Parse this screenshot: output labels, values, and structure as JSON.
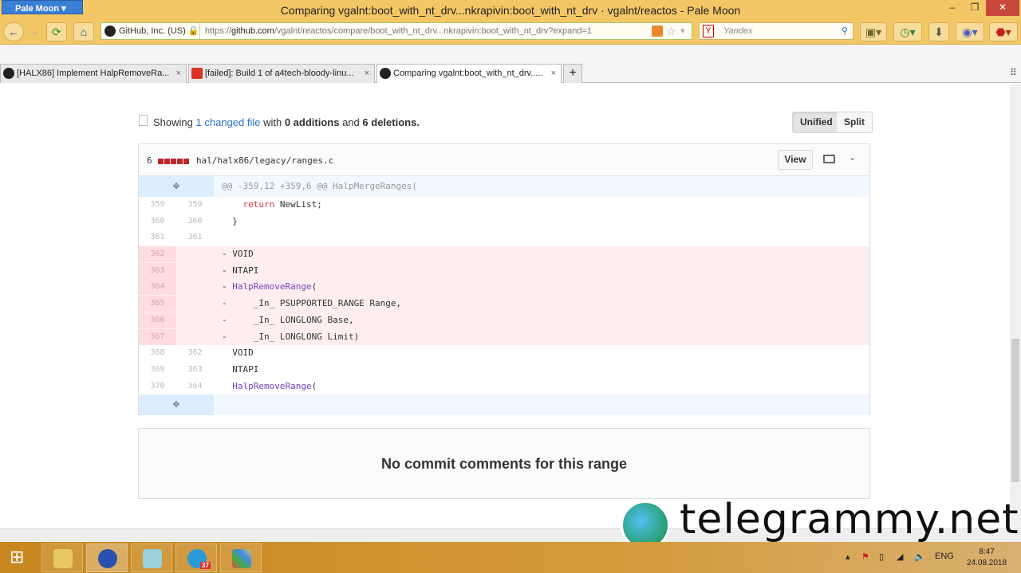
{
  "browser": {
    "app_button": "Pale Moon",
    "title": "Comparing vgalnt:boot_with_nt_drv...nkrapivin:boot_with_nt_drv · vgalnt/reactos - Pale Moon",
    "identity": "GitHub, Inc. (US)",
    "url_prefix": "https://",
    "url_domain": "github.com",
    "url_path": "/vgalnt/reactos/compare/boot_with_nt_drv...nkrapivin:boot_with_nt_drv?expand=1",
    "search_placeholder": "Yandex",
    "tabs": [
      {
        "label": "[HALX86] Implement HalpRemoveRa...",
        "icon": "github-icon"
      },
      {
        "label": "[failed]: Build 1 of a4tech-bloody-linu...",
        "icon": "failed-icon"
      },
      {
        "label": "Comparing vgalnt:boot_with_nt_drv.....",
        "icon": "github-icon"
      }
    ],
    "new_tab": "+"
  },
  "summary": {
    "prefix": "Showing",
    "changed": "1 changed file",
    "with": "with",
    "additions": "0 additions",
    "and": "and",
    "deletions": "6 deletions."
  },
  "view_toggle": {
    "unified": "Unified",
    "split": "Split"
  },
  "file": {
    "count": "6",
    "name": "hal/halx86/legacy/ranges.c",
    "view": "View",
    "hunk": "@@ -359,12 +359,6 @@ HalpMergeRanges(",
    "lines": [
      {
        "type": "ctx",
        "old": "359",
        "new": "359",
        "pre": "    ",
        "kw": "return",
        "rest": " NewList;"
      },
      {
        "type": "ctx",
        "old": "360",
        "new": "360",
        "pre": "  }",
        "kw": "",
        "rest": ""
      },
      {
        "type": "ctx",
        "old": "361",
        "new": "361",
        "pre": "",
        "kw": "",
        "rest": ""
      },
      {
        "type": "del",
        "old": "362",
        "new": "",
        "pre": "- VOID",
        "kw": "",
        "rest": ""
      },
      {
        "type": "del",
        "old": "363",
        "new": "",
        "pre": "- NTAPI",
        "kw": "",
        "rest": ""
      },
      {
        "type": "del",
        "old": "364",
        "new": "",
        "pre": "- ",
        "fn": "HalpRemoveRange",
        "rest": "("
      },
      {
        "type": "del",
        "old": "365",
        "new": "",
        "pre": "-     _In_ PSUPPORTED_RANGE Range,",
        "kw": "",
        "rest": ""
      },
      {
        "type": "del",
        "old": "366",
        "new": "",
        "pre": "-     _In_ LONGLONG Base,",
        "kw": "",
        "rest": ""
      },
      {
        "type": "del",
        "old": "367",
        "new": "",
        "pre": "-     _In_ LONGLONG Limit)",
        "kw": "",
        "rest": ""
      },
      {
        "type": "ctx",
        "old": "368",
        "new": "362",
        "pre": "  VOID",
        "kw": "",
        "rest": ""
      },
      {
        "type": "ctx",
        "old": "369",
        "new": "363",
        "pre": "  NTAPI",
        "kw": "",
        "rest": ""
      },
      {
        "type": "ctx",
        "old": "370",
        "new": "364",
        "pre": "  ",
        "fn": "HalpRemoveRange",
        "rest": "("
      }
    ]
  },
  "no_comments": "No commit comments for this range",
  "watermark": "telegrammy.net",
  "taskbar": {
    "lang": "ENG",
    "time": "8:47",
    "date": "24.08.2018",
    "telegram_badge": "37"
  }
}
